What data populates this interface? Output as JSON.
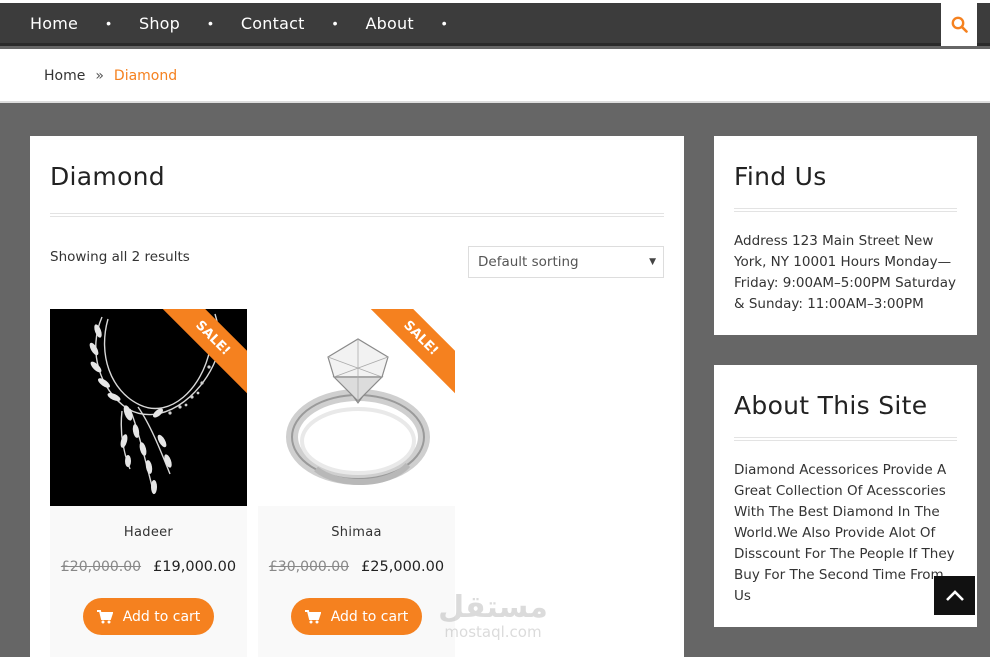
{
  "nav": {
    "items": [
      {
        "label": "Home"
      },
      {
        "label": "Shop"
      },
      {
        "label": "Contact"
      },
      {
        "label": "About"
      }
    ],
    "separator": "•",
    "search_icon": "search-icon"
  },
  "breadcrumb": {
    "home": "Home",
    "separator": "»",
    "current": "Diamond"
  },
  "main": {
    "title": "Diamond",
    "result_count": "Showing all 2 results",
    "sort": {
      "selected": "Default sorting"
    },
    "sale_badge": "SALE!",
    "products": [
      {
        "name": "Hadeer",
        "old_price": "£20,000.00",
        "price": "£19,000.00",
        "button": "Add to cart"
      },
      {
        "name": "Shimaa",
        "old_price": "£30,000.00",
        "price": "£25,000.00",
        "button": "Add to cart"
      }
    ]
  },
  "sidebar": {
    "find_us": {
      "title": "Find Us",
      "text": "Address 123 Main Street New York, NY 10001 Hours Monday—Friday: 9:00AM–5:00PM Saturday & Sunday: 11:00AM–3:00PM"
    },
    "about": {
      "title": "About This Site",
      "text": "Diamond Acessorices Provide A Great Collection Of Acesscories With The Best Diamond In The World.We Also Provide Alot Of Disscount For The People If They Buy For The Second Time From Us"
    }
  },
  "watermark": {
    "arabic": "مستقل",
    "latin": "mostaql.com"
  },
  "colors": {
    "accent": "#f5811f",
    "nav_bg": "#3c3c3c",
    "page_bg": "#666666"
  }
}
